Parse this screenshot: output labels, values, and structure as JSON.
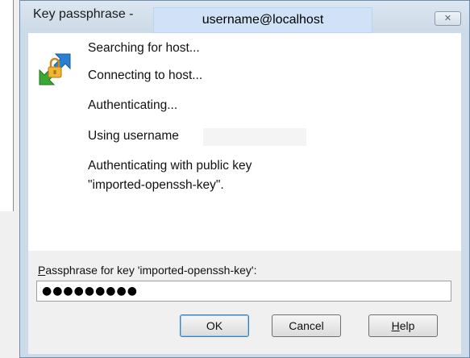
{
  "window": {
    "title": "Key passphrase -",
    "title_overlay": "username@localhost",
    "close_glyph": "✕"
  },
  "log": {
    "icon": "key-lock-icon",
    "lines": [
      "Searching for host...",
      "Connecting to host...",
      "Authenticating...",
      "Using username",
      "Authenticating with public key",
      "\"imported-openssh-key\"."
    ]
  },
  "passphrase": {
    "label_accel": "P",
    "label_rest": "assphrase for key 'imported-openssh-key':",
    "value": "●●●●●●●●●"
  },
  "buttons": {
    "ok": "OK",
    "cancel": "Cancel",
    "help_accel": "H",
    "help_rest": "elp"
  },
  "colors": {
    "title_overlay_bg": "#cfe2f7",
    "frame": "#cddbe9",
    "default_button_border": "#3c7fb1"
  }
}
